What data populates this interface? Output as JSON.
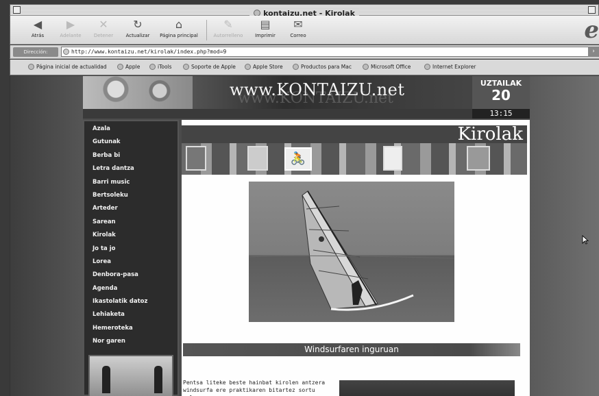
{
  "window": {
    "title": "kontaizu.net - Kirolak"
  },
  "toolbar": {
    "buttons": [
      {
        "label": "Atrás",
        "icon": "back-arrow-icon",
        "enabled": true
      },
      {
        "label": "Adelante",
        "icon": "forward-arrow-icon",
        "enabled": false
      },
      {
        "label": "Detener",
        "icon": "stop-icon",
        "enabled": false
      },
      {
        "label": "Actualizar",
        "icon": "refresh-icon",
        "enabled": true
      },
      {
        "label": "Página principal",
        "icon": "home-icon",
        "enabled": true
      },
      {
        "label": "Autorrelleno",
        "icon": "autofill-icon",
        "enabled": false
      },
      {
        "label": "Imprimir",
        "icon": "print-icon",
        "enabled": true
      },
      {
        "label": "Correo",
        "icon": "mail-icon",
        "enabled": true
      }
    ]
  },
  "address": {
    "label": "Dirección:",
    "url": "http://www.kontaizu.net/kirolak/index.php?mod=9"
  },
  "favorites": [
    "Página inicial de actualidad",
    "Apple",
    "iTools",
    "Soporte de Apple",
    "Apple Store",
    "Productos para Mac",
    "Microsoft Office",
    "Internet Explorer"
  ],
  "site": {
    "logo": "www.KONTAIZU.net",
    "date": {
      "month": "UZTAILAK",
      "day": "20",
      "time": "13:15"
    },
    "nav": [
      "Azala",
      "Gutunak",
      "Berba bi",
      "Letra dantza",
      "Barri music",
      "Bertsoleku",
      "Arteder",
      "Sarean",
      "Kirolak",
      "Jo ta jo",
      "Lorea",
      "Denbora-pasa",
      "Agenda",
      "Ikastolatik datoz",
      "Lehiaketa",
      "Hemeroteka",
      "Nor garen"
    ],
    "banner_title": "Kirolak",
    "section_title": "Windsurfaren inguruan",
    "intro_text": "Pentsa liteke beste hainbat kirolen antzera windsurfa ere praktikaren bitartez sortu zela,"
  },
  "colors": {
    "page_bg": "#4b4b4b",
    "nav_bg": "#2c2c2c",
    "accent": "#555555"
  }
}
